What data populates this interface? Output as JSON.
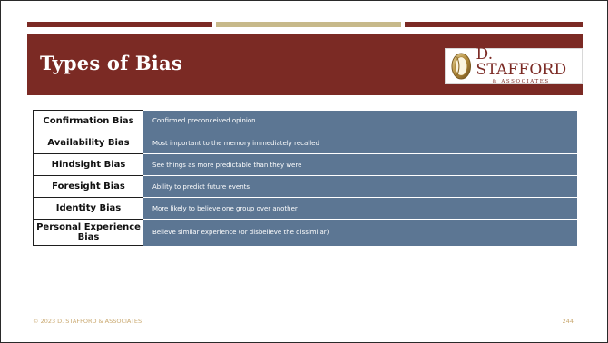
{
  "slide": {
    "title": "Types of Bias",
    "logo": {
      "name": "D. STAFFORD",
      "subtitle": "& ASSOCIATES"
    },
    "colors": {
      "banner": "#7b2a24",
      "accent": "#c7b98a",
      "table_fill": "#5c7693",
      "footer": "#c9a86f"
    }
  },
  "biases": [
    {
      "term": "Confirmation Bias",
      "description": "Confirmed preconceived opinion"
    },
    {
      "term": "Availability Bias",
      "description": "Most important to the memory immediately recalled"
    },
    {
      "term": "Hindsight Bias",
      "description": "See things as more predictable than they were"
    },
    {
      "term": "Foresight Bias",
      "description": "Ability to predict future events"
    },
    {
      "term": "Identity Bias",
      "description": "More likely to believe one group over another"
    },
    {
      "term": "Personal Experience Bias",
      "description": "Believe similar experience (or disbelieve the dissimilar)"
    }
  ],
  "footer": {
    "copyright": "© 2023 D. STAFFORD & ASSOCIATES",
    "page_number": "244"
  }
}
